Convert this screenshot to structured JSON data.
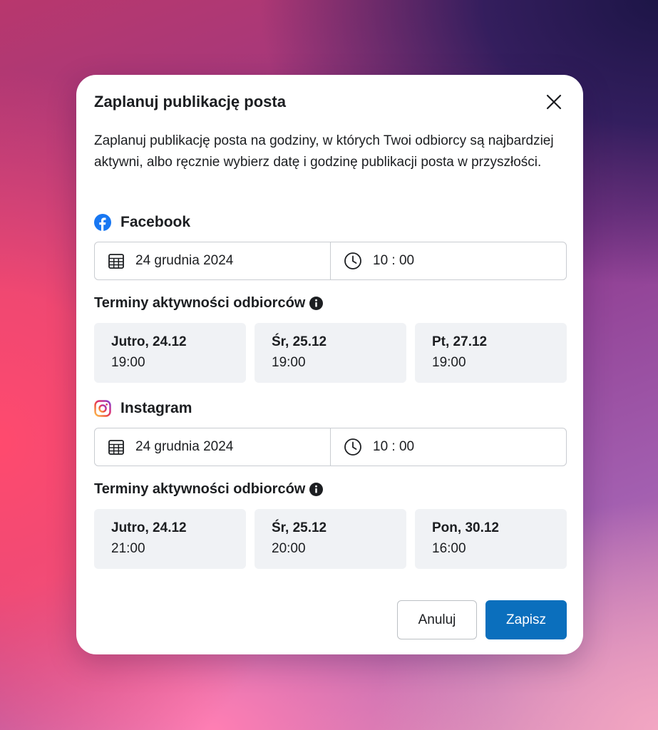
{
  "modal": {
    "title": "Zaplanuj publikację posta",
    "description": "Zaplanuj publikację posta na godziny, w których Twoi odbiorcy są najbardziej aktywni, albo ręcznie wybierz datę i godzinę publikacji posta w przyszłości.",
    "close_icon": "close-icon"
  },
  "facebook": {
    "name": "Facebook",
    "icon": "facebook-icon",
    "brand_color": "#1877f2",
    "date": "24 grudnia 2024",
    "time": "10 : 00",
    "activity_heading": "Terminy aktywności odbiorców",
    "slots": [
      {
        "day": "Jutro, 24.12",
        "time": "19:00"
      },
      {
        "day": "Śr, 25.12",
        "time": "19:00"
      },
      {
        "day": "Pt, 27.12",
        "time": "19:00"
      }
    ]
  },
  "instagram": {
    "name": "Instagram",
    "icon": "instagram-icon",
    "date": "24 grudnia 2024",
    "time": "10 : 00",
    "activity_heading": "Terminy aktywności odbiorców",
    "slots": [
      {
        "day": "Jutro, 24.12",
        "time": "21:00"
      },
      {
        "day": "Śr, 25.12",
        "time": "20:00"
      },
      {
        "day": "Pon, 30.12",
        "time": "16:00"
      }
    ]
  },
  "footer": {
    "cancel_label": "Anuluj",
    "save_label": "Zapisz",
    "save_color": "#0b6fbd"
  }
}
